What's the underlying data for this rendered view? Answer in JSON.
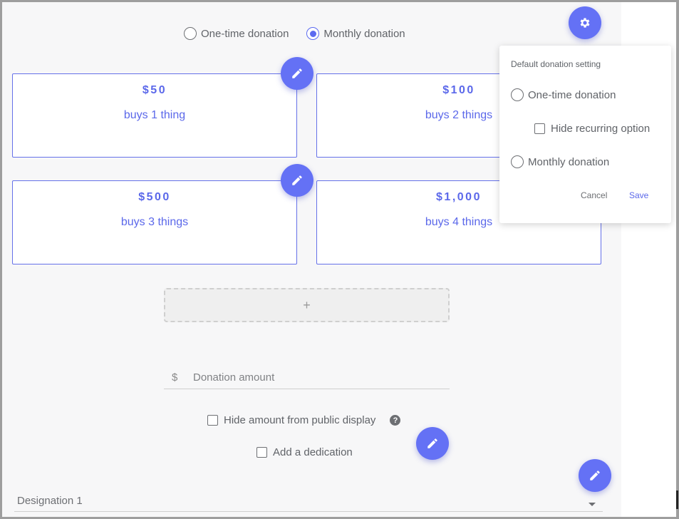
{
  "frequency": {
    "options": [
      "One-time donation",
      "Monthly donation"
    ],
    "selected": "Monthly donation"
  },
  "cards": [
    {
      "amount": "$50",
      "description": "buys 1 thing"
    },
    {
      "amount": "$100",
      "description": "buys 2 things"
    },
    {
      "amount": "$500",
      "description": "buys 3 things"
    },
    {
      "amount": "$1,000",
      "description": "buys 4 things"
    }
  ],
  "add_level": {
    "label": "+"
  },
  "amount_input": {
    "prefix": "$",
    "placeholder": "Donation amount",
    "value": ""
  },
  "options": {
    "hide_amount_label": "Hide amount from public display",
    "hide_amount_checked": false,
    "help_icon_glyph": "?",
    "dedication_label": "Add a dedication",
    "dedication_checked": false
  },
  "designation": {
    "value": "Designation 1"
  },
  "settings_popover": {
    "title": "Default donation setting",
    "option_one_time": "One-time donation",
    "hide_recurring_label": "Hide recurring option",
    "option_monthly": "Monthly donation",
    "cancel_label": "Cancel",
    "save_label": "Save"
  },
  "colors": {
    "accent": "#6471f5",
    "card_border": "#6571e9",
    "canvas_bg": "#f7f7f8"
  },
  "icons": {
    "settings": "gear-icon",
    "edit": "pencil-icon",
    "help": "question-circle-icon",
    "dropdown": "caret-down-icon"
  }
}
